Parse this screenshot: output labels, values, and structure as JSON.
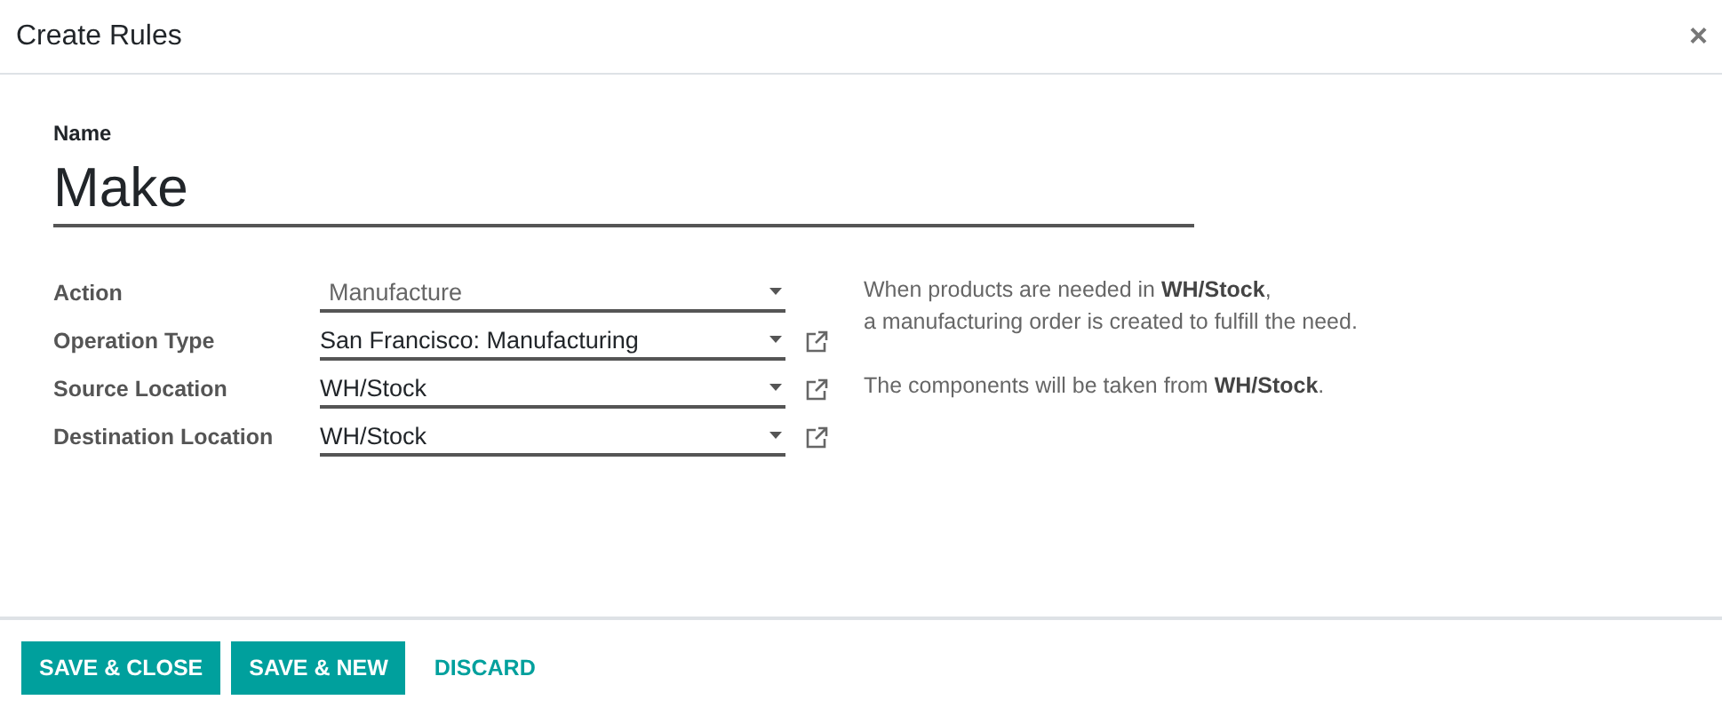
{
  "window": {
    "title": "Create Rules",
    "close": "×"
  },
  "name_field": {
    "label": "Name",
    "value": "Make"
  },
  "fields": [
    {
      "label": "Action",
      "value": "Manufacture",
      "kind": "select"
    },
    {
      "label": "Operation Type",
      "value": "San Francisco: Manufacturing",
      "kind": "link"
    },
    {
      "label": "Source Location",
      "value": "WH/Stock",
      "kind": "link"
    },
    {
      "label": "Destination Location",
      "value": "WH/Stock",
      "kind": "link"
    }
  ],
  "help": [
    "When products are needed in **WH/Stock**,\na manufacturing order is created to fulfill the need.",
    "The components will be taken from **WH/Stock**."
  ],
  "buttons": [
    {
      "label": "SAVE & CLOSE",
      "kind": "primary"
    },
    {
      "label": "SAVE & NEW",
      "kind": "primary"
    },
    {
      "label": "DISCARD",
      "kind": "link"
    }
  ]
}
